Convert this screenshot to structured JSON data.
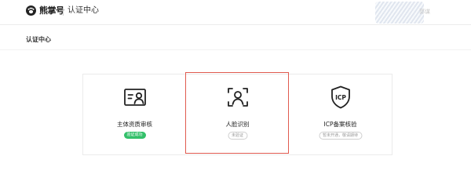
{
  "header": {
    "brand": "熊掌号",
    "page_name": "认证中心",
    "user_label": "郭谋"
  },
  "section_title": "认证中心",
  "cards": [
    {
      "label": "主体资质审核",
      "badge": "验证成功",
      "badge_color": "#33c06a",
      "icon": "id-card-icon"
    },
    {
      "label": "人脸识别",
      "badge": "未验证",
      "icon": "face-scan-icon"
    },
    {
      "label": "ICP备案核验",
      "badge": "暂未开通，敬请期待",
      "icon": "icp-shield-icon",
      "icon_text": "ICP"
    }
  ],
  "highlight_color": "#e05a4f"
}
